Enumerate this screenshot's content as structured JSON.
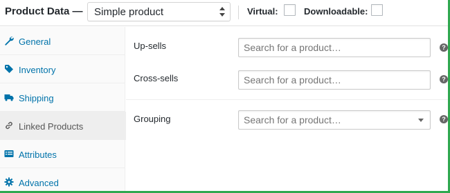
{
  "header": {
    "title": "Product Data —",
    "product_type": "Simple product",
    "virtual_label": "Virtual:",
    "downloadable_label": "Downloadable:"
  },
  "sidebar": {
    "items": [
      {
        "label": "General",
        "icon": "wrench-icon",
        "active": false
      },
      {
        "label": "Inventory",
        "icon": "tag-icon",
        "active": false
      },
      {
        "label": "Shipping",
        "icon": "truck-icon",
        "active": false
      },
      {
        "label": "Linked Products",
        "icon": "link-icon",
        "active": true
      },
      {
        "label": "Attributes",
        "icon": "list-icon",
        "active": false
      },
      {
        "label": "Advanced",
        "icon": "gear-icon",
        "active": false
      }
    ]
  },
  "linked": {
    "upsells_label": "Up-sells",
    "upsells_placeholder": "Search for a product…",
    "crosssells_label": "Cross-sells",
    "crosssells_placeholder": "Search for a product…",
    "grouping_label": "Grouping",
    "grouping_placeholder": "Search for a product…",
    "help_glyph": "?"
  },
  "colors": {
    "link": "#0073aa",
    "active_tab_bg": "#eeeeee",
    "frame_accent": "#2fa84f"
  }
}
